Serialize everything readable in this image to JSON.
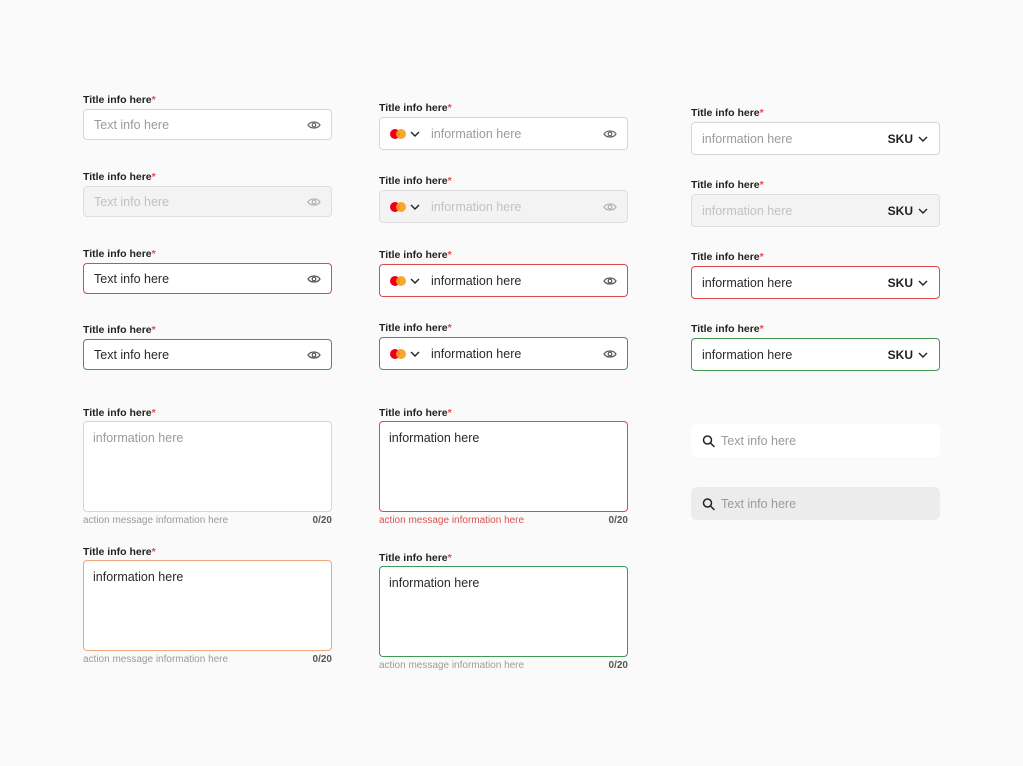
{
  "label": "Title info here",
  "required_mark": "*",
  "col1": {
    "text_placeholder": "Text info here",
    "text_value": "Text info here"
  },
  "col2": {
    "placeholder": "information here",
    "value": "information here"
  },
  "col3": {
    "placeholder": "information here",
    "value": "information here",
    "suffix": "SKU"
  },
  "textarea": {
    "placeholder": "information here",
    "value": "information here",
    "help": "action message information here",
    "counter": "0/20"
  },
  "search": {
    "placeholder": "Text info here"
  },
  "colors": {
    "error": "#dc4a4a",
    "success": "#3f9a53",
    "warning": "#f0a57c",
    "required": "#e5484d"
  }
}
